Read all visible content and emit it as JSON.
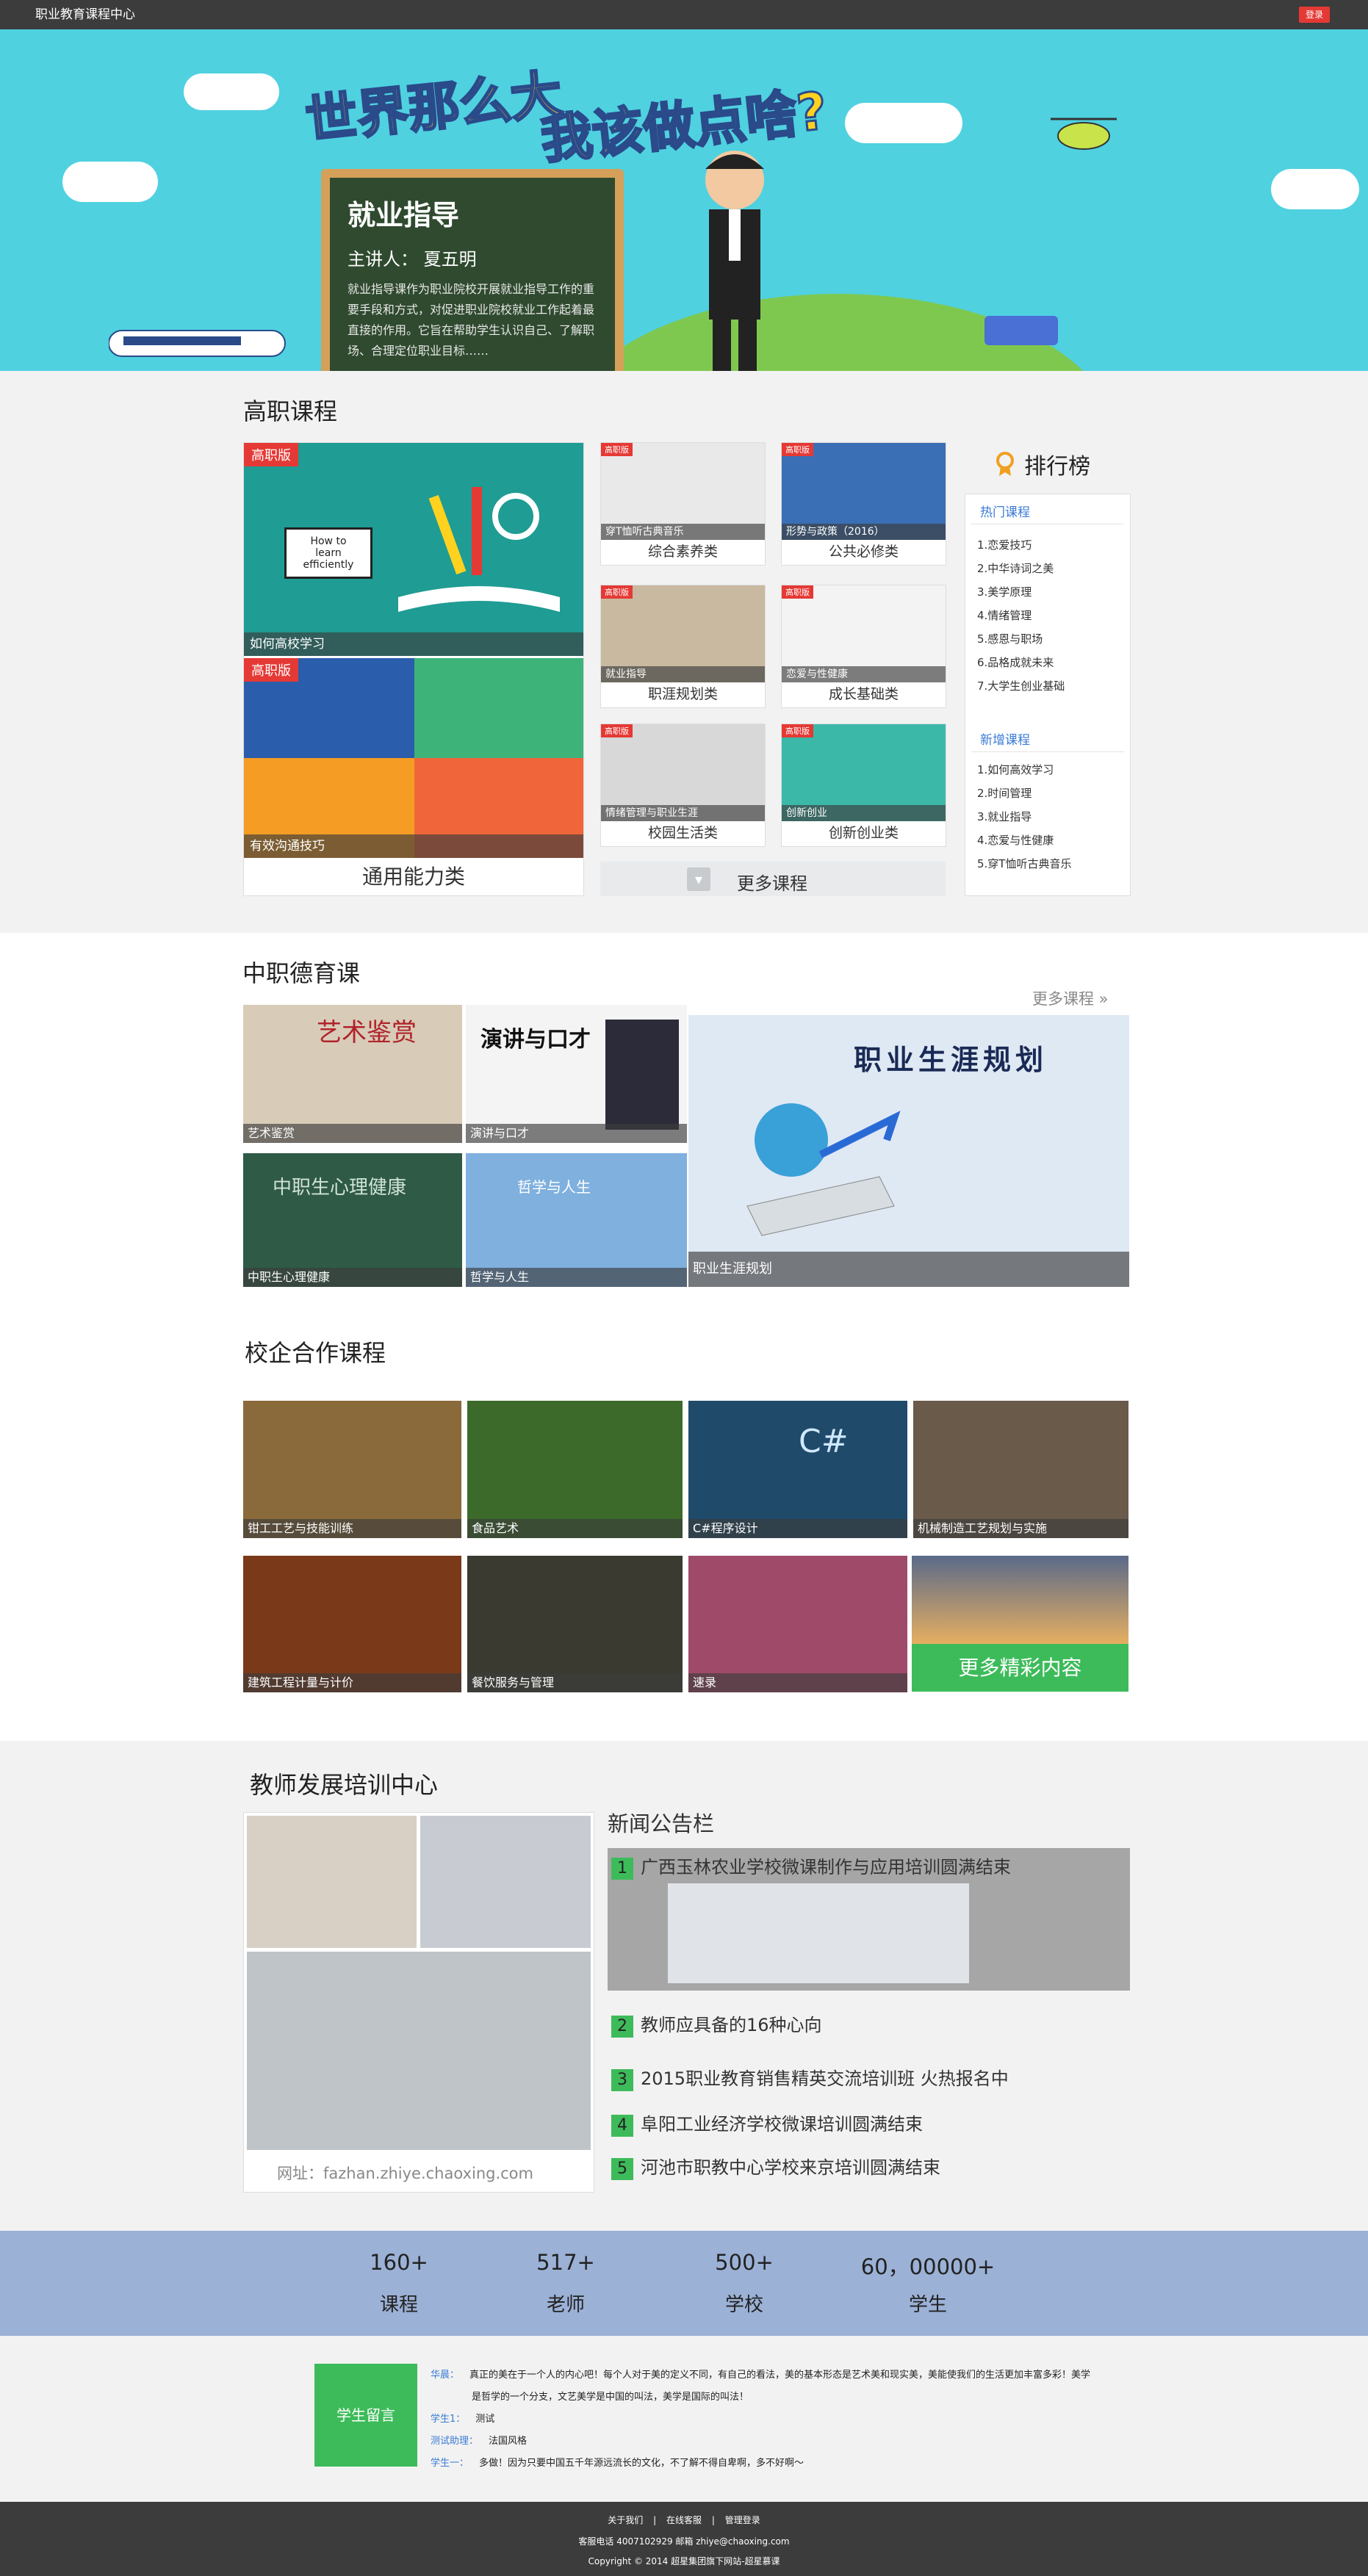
{
  "topbar": {
    "title": "职业教育课程中心",
    "login": "登录"
  },
  "banner": {
    "slogan_line1": "世界那么大",
    "slogan_line2": "我该做点啥?",
    "board_title": "就业指导",
    "board_speaker": "主讲人：",
    "board_speaker_name": "夏五明",
    "board_desc": "就业指导课作为职业院校开展就业指导工作的重要手段和方式，对促进职业院校就业工作起着最直接的作用。它旨在帮助学生认识自己、了解职场、合理定位职业目标……"
  },
  "gaozhi": {
    "title": "高职课程",
    "big_card": {
      "badge": "高职版",
      "top_label": "如何高校学习",
      "bottom_badge": "高职版",
      "bottom_label": "有效沟通技巧",
      "caption": "通用能力类",
      "book_text_1": "How to",
      "book_text_2": "learn",
      "book_text_3": "efficiently"
    },
    "small_cards": [
      {
        "badge": "高职版",
        "overlay": "穿T恤听古典音乐",
        "caption": "综合素养类"
      },
      {
        "badge": "高职版",
        "overlay": "形势与政策（2016）",
        "caption": "公共必修类"
      },
      {
        "badge": "高职版",
        "overlay": "就业指导",
        "caption": "职涯规划类"
      },
      {
        "badge": "高职版",
        "overlay": "恋爱与性健康",
        "caption": "成长基础类"
      },
      {
        "badge": "高职版",
        "overlay": "情绪管理与职业生涯",
        "caption": "校园生活类"
      },
      {
        "badge": "高职版",
        "overlay": "创新创业",
        "caption": "创新创业类"
      }
    ],
    "more": "更多课程"
  },
  "ranking": {
    "title": "排行榜",
    "hot_title": "热门课程",
    "hot": [
      "1.恋爱技巧",
      "2.中华诗词之美",
      "3.美学原理",
      "4.情绪管理",
      "5.感恩与职场",
      "6.品格成就未来",
      "7.大学生创业基础"
    ],
    "new_title": "新增课程",
    "new": [
      "1.如何高效学习",
      "2.时间管理",
      "3.就业指导",
      "4.恋爱与性健康",
      "5.穿T恤听古典音乐"
    ]
  },
  "zhongzhi": {
    "title": "中职德育课",
    "more": "更多课程 »",
    "tiles": [
      {
        "label": "艺术鉴赏",
        "art": "艺术鉴赏"
      },
      {
        "label": "演讲与口才",
        "art": "演讲与口才"
      },
      {
        "label": "中职生心理健康",
        "art": "中职生心理健康"
      },
      {
        "label": "哲学与人生",
        "art": "哲学与人生"
      }
    ],
    "big_tile": {
      "label": "职业生涯规划",
      "art": "职业生涯规划"
    }
  },
  "xiaoqi": {
    "title": "校企合作课程",
    "tiles": [
      "钳工工艺与技能训练",
      "食品艺术",
      "C#程序设计",
      "机械制造工艺规划与实施",
      "建筑工程计量与计价",
      "餐饮服务与管理",
      "速录"
    ],
    "csharp_mark": "C#",
    "more": "更多精彩内容"
  },
  "teacher": {
    "title": "教师发展培训中心",
    "url": "网址：fazhan.zhiye.chaoxing.com",
    "news_title": "新闻公告栏",
    "news": [
      {
        "num": "1",
        "text": "广西玉林农业学校微课制作与应用培训圆满结束"
      },
      {
        "num": "2",
        "text": "教师应具备的16种心向"
      },
      {
        "num": "3",
        "text": "2015职业教育销售精英交流培训班 火热报名中"
      },
      {
        "num": "4",
        "text": "阜阳工业经济学校微课培训圆满结束"
      },
      {
        "num": "5",
        "text": "河池市职教中心学校来京培训圆满结束"
      }
    ]
  },
  "stats": [
    {
      "num": "160+",
      "label": "课程"
    },
    {
      "num": "517+",
      "label": "老师"
    },
    {
      "num": "500+",
      "label": "学校"
    },
    {
      "num": "60，00000+",
      "label": "学生"
    }
  ],
  "messages": {
    "button": "学生留言",
    "rows": [
      {
        "name": "华晨：",
        "text": "真正的美在于一个人的内心吧！每个人对于美的定义不同，有自己的看法，美的基本形态是艺术美和现实美，美能使我们的生活更加丰富多彩！美学"
      },
      {
        "name": "",
        "text": "是哲学的一个分支，文艺美学是中国的叫法，美学是国际的叫法！"
      },
      {
        "name": "学生1：",
        "text": "测试"
      },
      {
        "name": "测试助理：",
        "text": "法国风格"
      },
      {
        "name": "学生一：",
        "text": "多做！因为只要中国五千年源远流长的文化，不了解不得自卑啊，多不好啊～"
      }
    ]
  },
  "footer": {
    "link_about": "关于我们",
    "link_online": "在线客服",
    "link_admin": "管理登录",
    "sep": "|",
    "contact": "客服电话 4007102929 邮箱 zhiye@chaoxing.com",
    "copyright": "Copyright © 2014 超星集团旗下网站-超星慕课"
  }
}
